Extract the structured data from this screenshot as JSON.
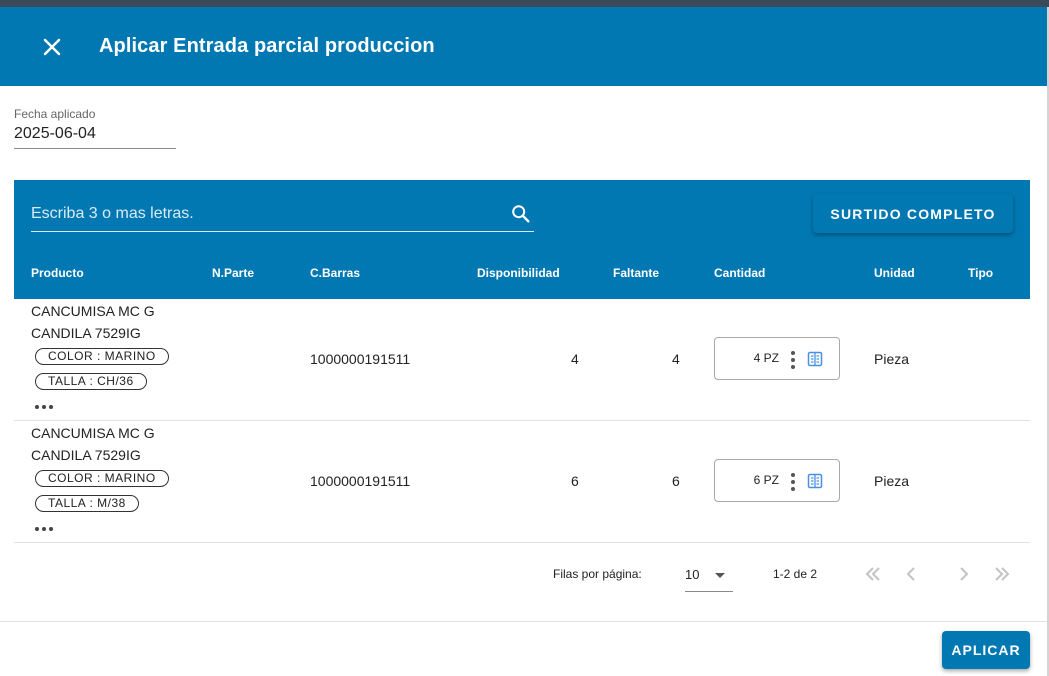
{
  "dialog": {
    "title": "Aplicar Entrada parcial produccion",
    "close_icon": "close-icon"
  },
  "date": {
    "label": "Fecha aplicado",
    "value": "2025-06-04"
  },
  "search": {
    "placeholder": "Escriba 3 o mas letras.",
    "icon": "search-icon"
  },
  "toolbar": {
    "surtido_label": "SURTIDO COMPLETO"
  },
  "columns": [
    "Producto",
    "N.Parte",
    "C.Barras",
    "Disponibilidad",
    "Faltante",
    "Cantidad",
    "Unidad",
    "Tipo"
  ],
  "rows": [
    {
      "product_line1": "CANCUMISA MC G",
      "product_line2": "CANDILA 7529IG",
      "chip1": "COLOR : MARINO",
      "chip2": "TALLA : CH/36",
      "part": "",
      "barcode": "1000000191511",
      "available": "4",
      "missing": "4",
      "quantity": "4 PZ",
      "unit": "Pieza",
      "type": ""
    },
    {
      "product_line1": "CANCUMISA MC G",
      "product_line2": "CANDILA 7529IG",
      "chip1": "COLOR : MARINO",
      "chip2": "TALLA : M/38",
      "part": "",
      "barcode": "1000000191511",
      "available": "6",
      "missing": "6",
      "quantity": "6 PZ",
      "unit": "Pieza",
      "type": ""
    }
  ],
  "pagination": {
    "rows_label": "Filas por página:",
    "rows_value": "10",
    "range": "1-2 de 2"
  },
  "footer": {
    "apply_label": "APLICAR"
  },
  "colors": {
    "primary": "#0278b3",
    "accent_icon": "#4a90e2"
  }
}
